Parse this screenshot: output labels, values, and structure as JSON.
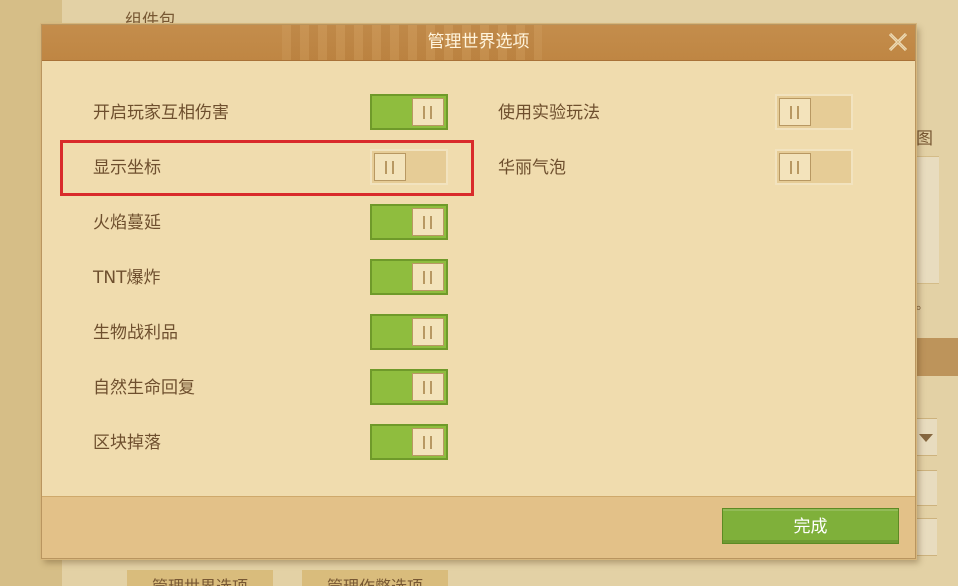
{
  "background": {
    "heading": "组件包",
    "right_text": "图",
    "right_dot": "。",
    "bottom_buttons": [
      "管理世界选项",
      "管理作弊选项"
    ]
  },
  "dialog": {
    "title": "管理世界选项",
    "close_icon": "close-icon",
    "left_options": [
      {
        "label": "开启玩家互相伤害",
        "enabled": true
      },
      {
        "label": "显示坐标",
        "enabled": false
      },
      {
        "label": "火焰蔓延",
        "enabled": true
      },
      {
        "label": "TNT爆炸",
        "enabled": true
      },
      {
        "label": "生物战利品",
        "enabled": true
      },
      {
        "label": "自然生命回复",
        "enabled": true
      },
      {
        "label": "区块掉落",
        "enabled": true
      }
    ],
    "right_options": [
      {
        "label": "使用实验玩法",
        "enabled": false
      },
      {
        "label": "华丽气泡",
        "enabled": false
      }
    ],
    "done_label": "完成"
  },
  "colors": {
    "header": "#c48d4c",
    "toggle_on": "#8fbd3e",
    "toggle_off": "#e6cc96",
    "done_button": "#7fb03a",
    "highlight": "#d92b2b"
  }
}
